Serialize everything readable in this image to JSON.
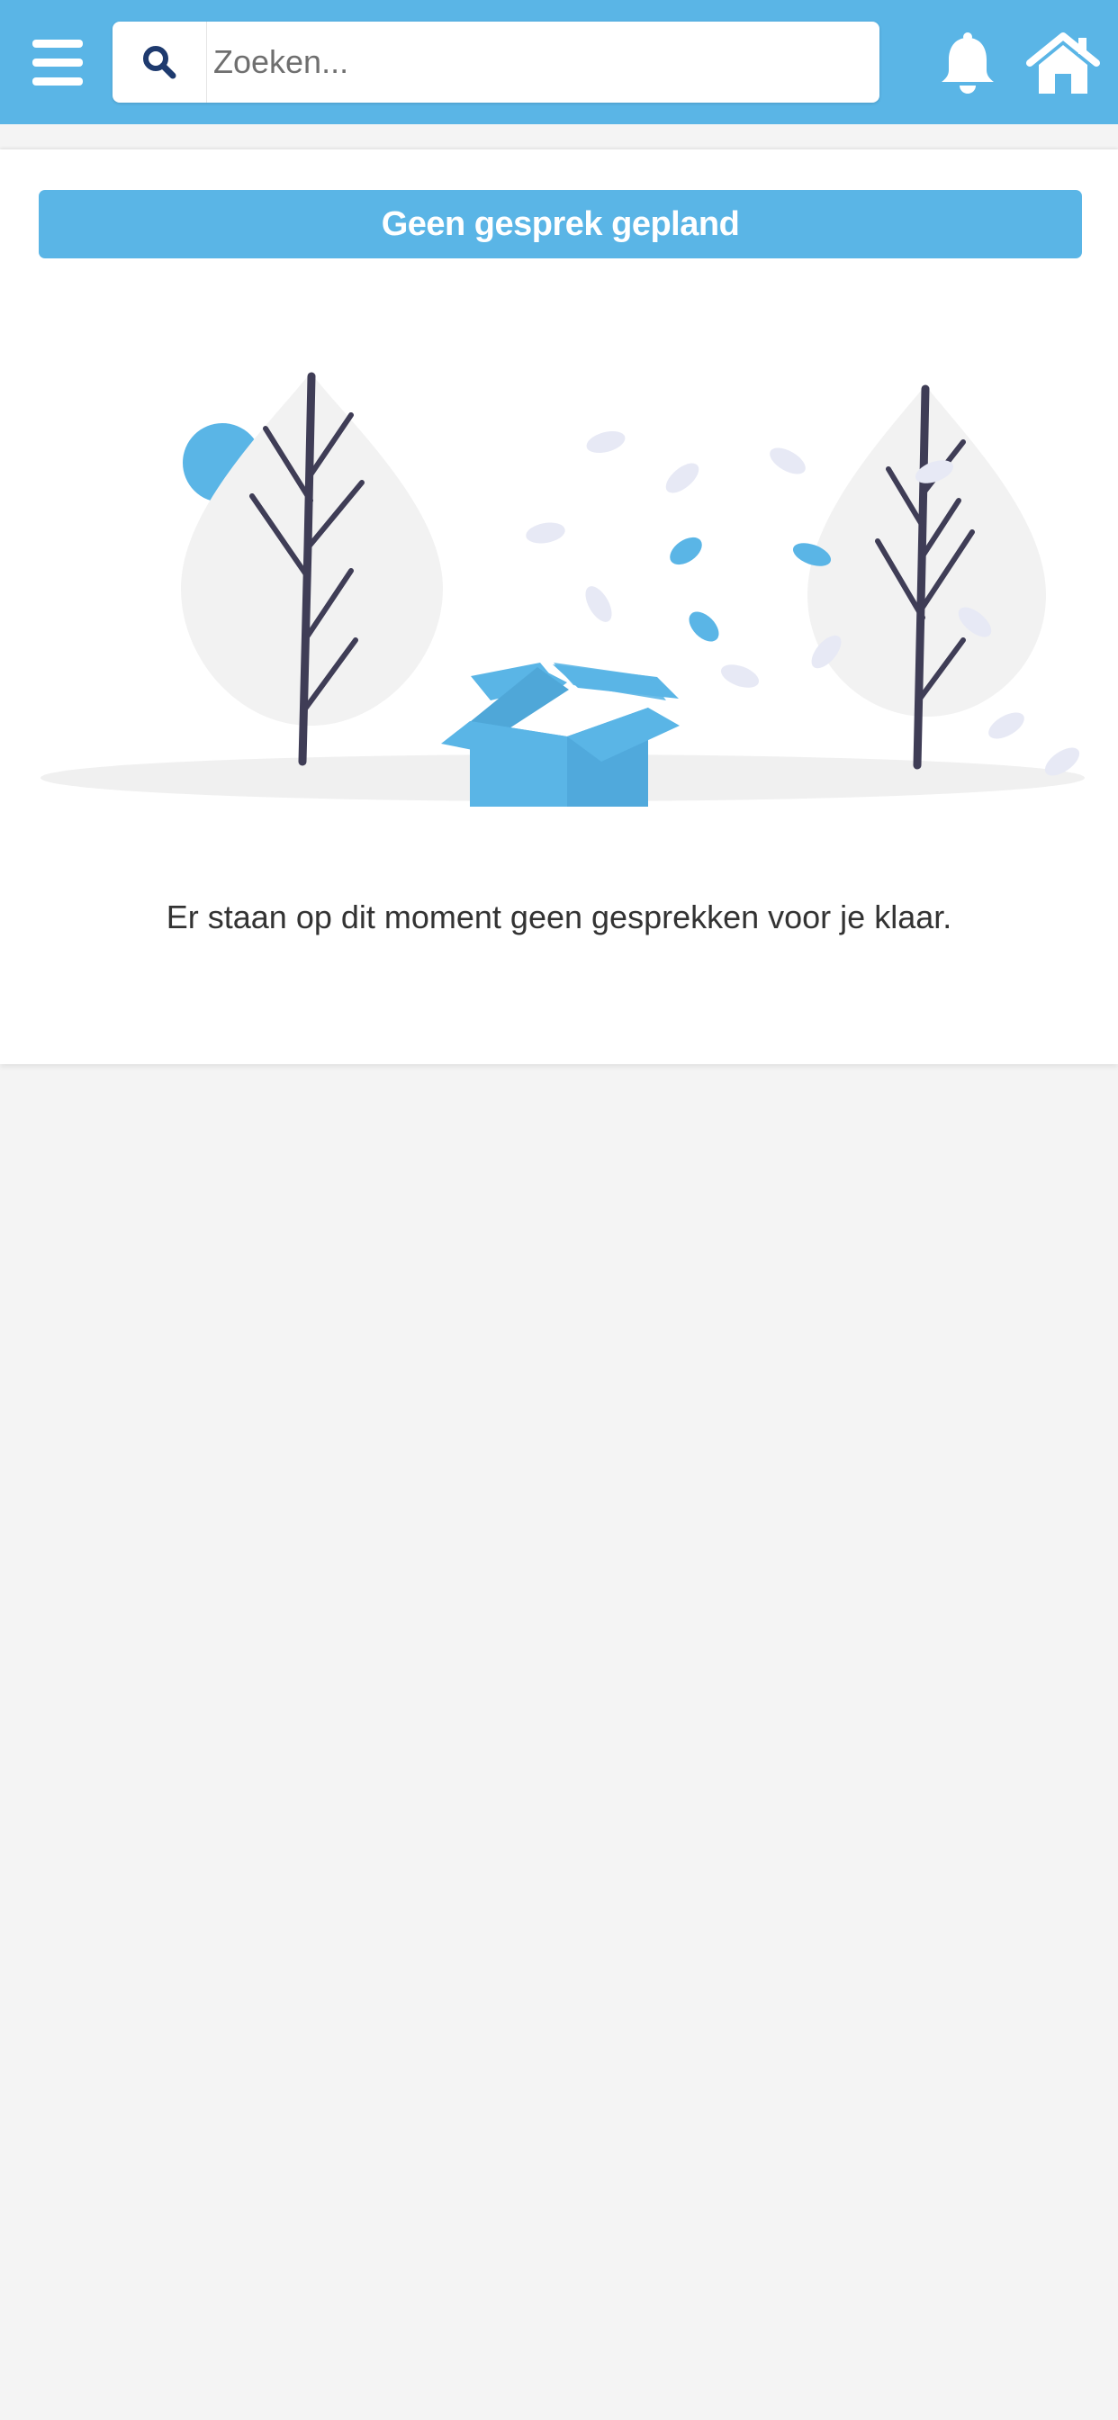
{
  "header": {
    "search": {
      "placeholder": "Zoeken...",
      "value": ""
    },
    "icons": {
      "menu": "hamburger-menu-icon",
      "search": "search-icon",
      "notifications": "bell-icon",
      "home": "home-icon"
    }
  },
  "main": {
    "banner_text": "Geen gesprek gepland",
    "empty_message": "Er staan op dit moment geen gesprekken voor je klaar."
  },
  "colors": {
    "primary": "#5ab5e6",
    "dark_blue_icon": "#1e3a6e",
    "tree_trunk": "#3f3d56",
    "page_background": "#f4f4f4",
    "card_background": "#ffffff",
    "text": "#333333"
  }
}
